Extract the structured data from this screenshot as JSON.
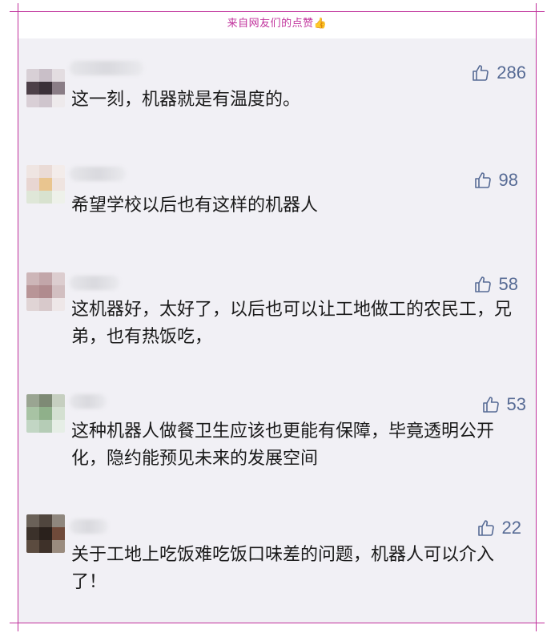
{
  "header": {
    "caption": "来自网友们的点赞",
    "caption_icon": "thumbs-up-emoji"
  },
  "colors": {
    "accent": "#c0309b",
    "like": "#576b95",
    "panel_bg": "#f1f0f5"
  },
  "comments": [
    {
      "text": "这一刻，机器就是有温度的。",
      "likes": "286"
    },
    {
      "text": "希望学校以后也有这样的机器人",
      "likes": "98"
    },
    {
      "text": "这机器好，太好了，以后也可以让工地做工的农民工，兄弟，也有热饭吃，",
      "likes": "58"
    },
    {
      "text": "这种机器人做餐卫生应该也更能有保障，毕竟透明公开化，隐约能预见未来的发展空间",
      "likes": "53"
    },
    {
      "text": "关于工地上吃饭难吃饭口味差的问题，机器人可以介入了！",
      "likes": "22"
    }
  ]
}
